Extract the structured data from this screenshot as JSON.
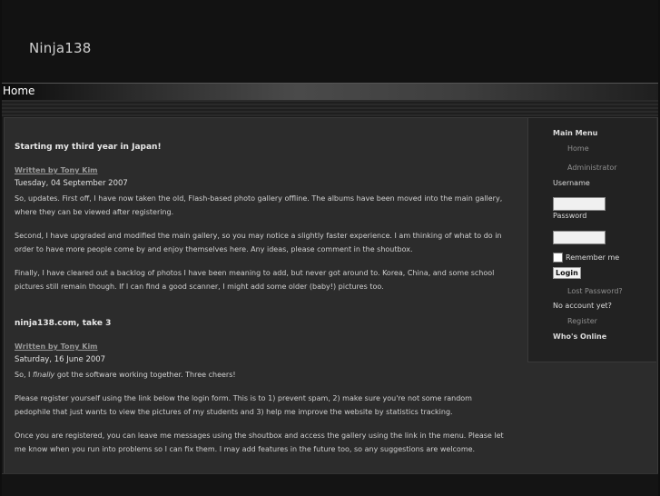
{
  "site": {
    "title": "Ninja138"
  },
  "nav": {
    "home": "Home"
  },
  "articles": [
    {
      "title": "Starting my third year in Japan!",
      "author": "Written by Tony Kim",
      "date": "Tuesday, 04 September 2007",
      "p1": "So, updates. First off, I have now taken the old, Flash-based photo gallery offline.  The albums have been moved into the main gallery, where they can be viewed after registering.",
      "p2": "Second, I have upgraded and modified the main gallery, so you may notice a slightly faster experience.  I am thinking of what to do in order to have more people come by and enjoy themselves here.  Any ideas, please comment in the shoutbox.",
      "p3": "Finally, I have cleared out a backlog of photos I have been meaning to add, but never got around to.  Korea, China, and some school pictures still remain though.  If I can find a good scanner, I might add some older (baby!) pictures too."
    },
    {
      "title": "ninja138.com, take 3",
      "author": "Written by Tony Kim",
      "date": "Saturday, 16 June 2007",
      "p1_a": "So, I ",
      "p1_em": "finally",
      "p1_b": " got the software working together.  Three cheers!",
      "p2": "Please register yourself using the link below the login form.  This is to 1) prevent spam, 2) make sure you're not some random pedophile that just wants to view the pictures of my students and 3) help me improve the website by statistics tracking.",
      "p3": "Once you are registered, you can leave me messages using the shoutbox and access the gallery using the link in the menu.  Please let me know when you run into problems so I can fix them.  I may add features in the future too, so any suggestions are welcome."
    }
  ],
  "sidebar": {
    "main_menu": "Main Menu",
    "home": "Home",
    "administrator": "Administrator",
    "username_label": "Username",
    "username_value": "",
    "password_label": "Password",
    "password_value": "",
    "remember_me": "Remember me",
    "remember_checked": false,
    "login": "Login",
    "lost_password": "Lost Password?",
    "no_account": "No account yet?",
    "register": "Register",
    "whos_online": "Who's Online"
  }
}
